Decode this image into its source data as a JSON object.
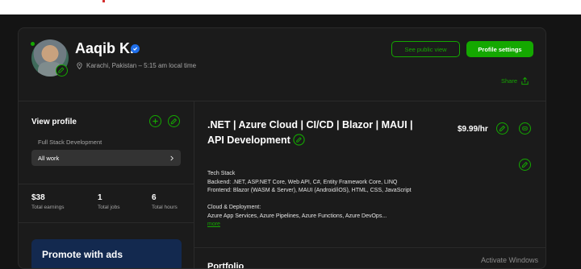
{
  "profile": {
    "name": "Aaqib K.",
    "location": "Karachi, Pakistan – 5:15 am local time"
  },
  "header_actions": {
    "public_view": "See public view",
    "settings": "Profile settings",
    "share": "Share"
  },
  "sidebar": {
    "view_profile": "View profile",
    "specialization": "Full Stack Development",
    "all_work": "All work",
    "stats": [
      {
        "value": "$38",
        "label": "Total earnings"
      },
      {
        "value": "1",
        "label": "Total jobs"
      },
      {
        "value": "6",
        "label": "Total hours"
      }
    ],
    "promo": "Promote with ads"
  },
  "main": {
    "title": ".NET | Azure Cloud | CI/CD | Blazor | MAUI | API Development",
    "rate": "$9.99/hr",
    "description_lines": [
      "Tech Stack",
      "Backend: .NET, ASP.NET Core, Web API, C#, Entity Framework Core, LINQ",
      "Frontend: Blazor (WASM & Server), MAUI (Android/iOS), HTML, CSS, JavaScript",
      "",
      "Cloud & Deployment:",
      "Azure App Services, Azure Pipelines, Azure Functions, Azure DevOps..."
    ],
    "more": "more",
    "portfolio": "Portfolio"
  },
  "watermark": "Activate Windows",
  "colors": {
    "accent": "#14a800",
    "background": "#141414",
    "card": "#1b1b1b",
    "promo": "#13294f"
  }
}
